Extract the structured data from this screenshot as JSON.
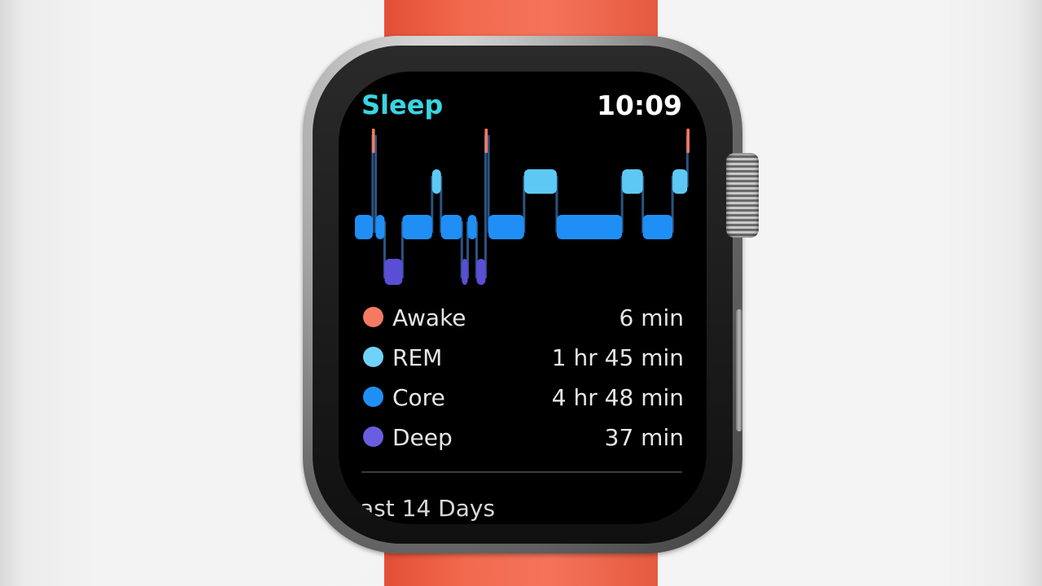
{
  "screen": {
    "app_title": "Sleep",
    "time": "10:09"
  },
  "hypnogram": {
    "stages": [
      "Awake",
      "REM",
      "Core",
      "Deep"
    ],
    "segments": [
      {
        "stage": "Core",
        "start": 0,
        "end": 6
      },
      {
        "stage": "Awake",
        "start": 6,
        "end": 7
      },
      {
        "stage": "Core",
        "start": 7,
        "end": 10
      },
      {
        "stage": "Deep",
        "start": 10,
        "end": 16
      },
      {
        "stage": "Core",
        "start": 16,
        "end": 26
      },
      {
        "stage": "REM",
        "start": 26,
        "end": 29
      },
      {
        "stage": "Core",
        "start": 29,
        "end": 36
      },
      {
        "stage": "Deep",
        "start": 36,
        "end": 38
      },
      {
        "stage": "Core",
        "start": 38,
        "end": 41
      },
      {
        "stage": "Deep",
        "start": 41,
        "end": 44
      },
      {
        "stage": "Awake",
        "start": 44,
        "end": 45
      },
      {
        "stage": "Core",
        "start": 45,
        "end": 57
      },
      {
        "stage": "REM",
        "start": 57,
        "end": 68
      },
      {
        "stage": "Core",
        "start": 68,
        "end": 90
      },
      {
        "stage": "REM",
        "start": 90,
        "end": 97
      },
      {
        "stage": "Core",
        "start": 97,
        "end": 107
      },
      {
        "stage": "REM",
        "start": 107,
        "end": 112
      },
      {
        "stage": "Awake",
        "start": 112,
        "end": 113
      }
    ],
    "colors": {
      "Awake": "#f47a62",
      "REM": "#5ec8f5",
      "Core": "#1f8ff5",
      "Deep": "#5b4ed6"
    }
  },
  "legend": [
    {
      "label": "Awake",
      "value": "6 min",
      "color": "#f47a62"
    },
    {
      "label": "REM",
      "value": "1 hr 45 min",
      "color": "#70d2fb"
    },
    {
      "label": "Core",
      "value": "4 hr 48 min",
      "color": "#1f8ff5"
    },
    {
      "label": "Deep",
      "value": "37 min",
      "color": "#6a5ee0"
    }
  ],
  "footer": {
    "label": "ast 14 Days"
  }
}
